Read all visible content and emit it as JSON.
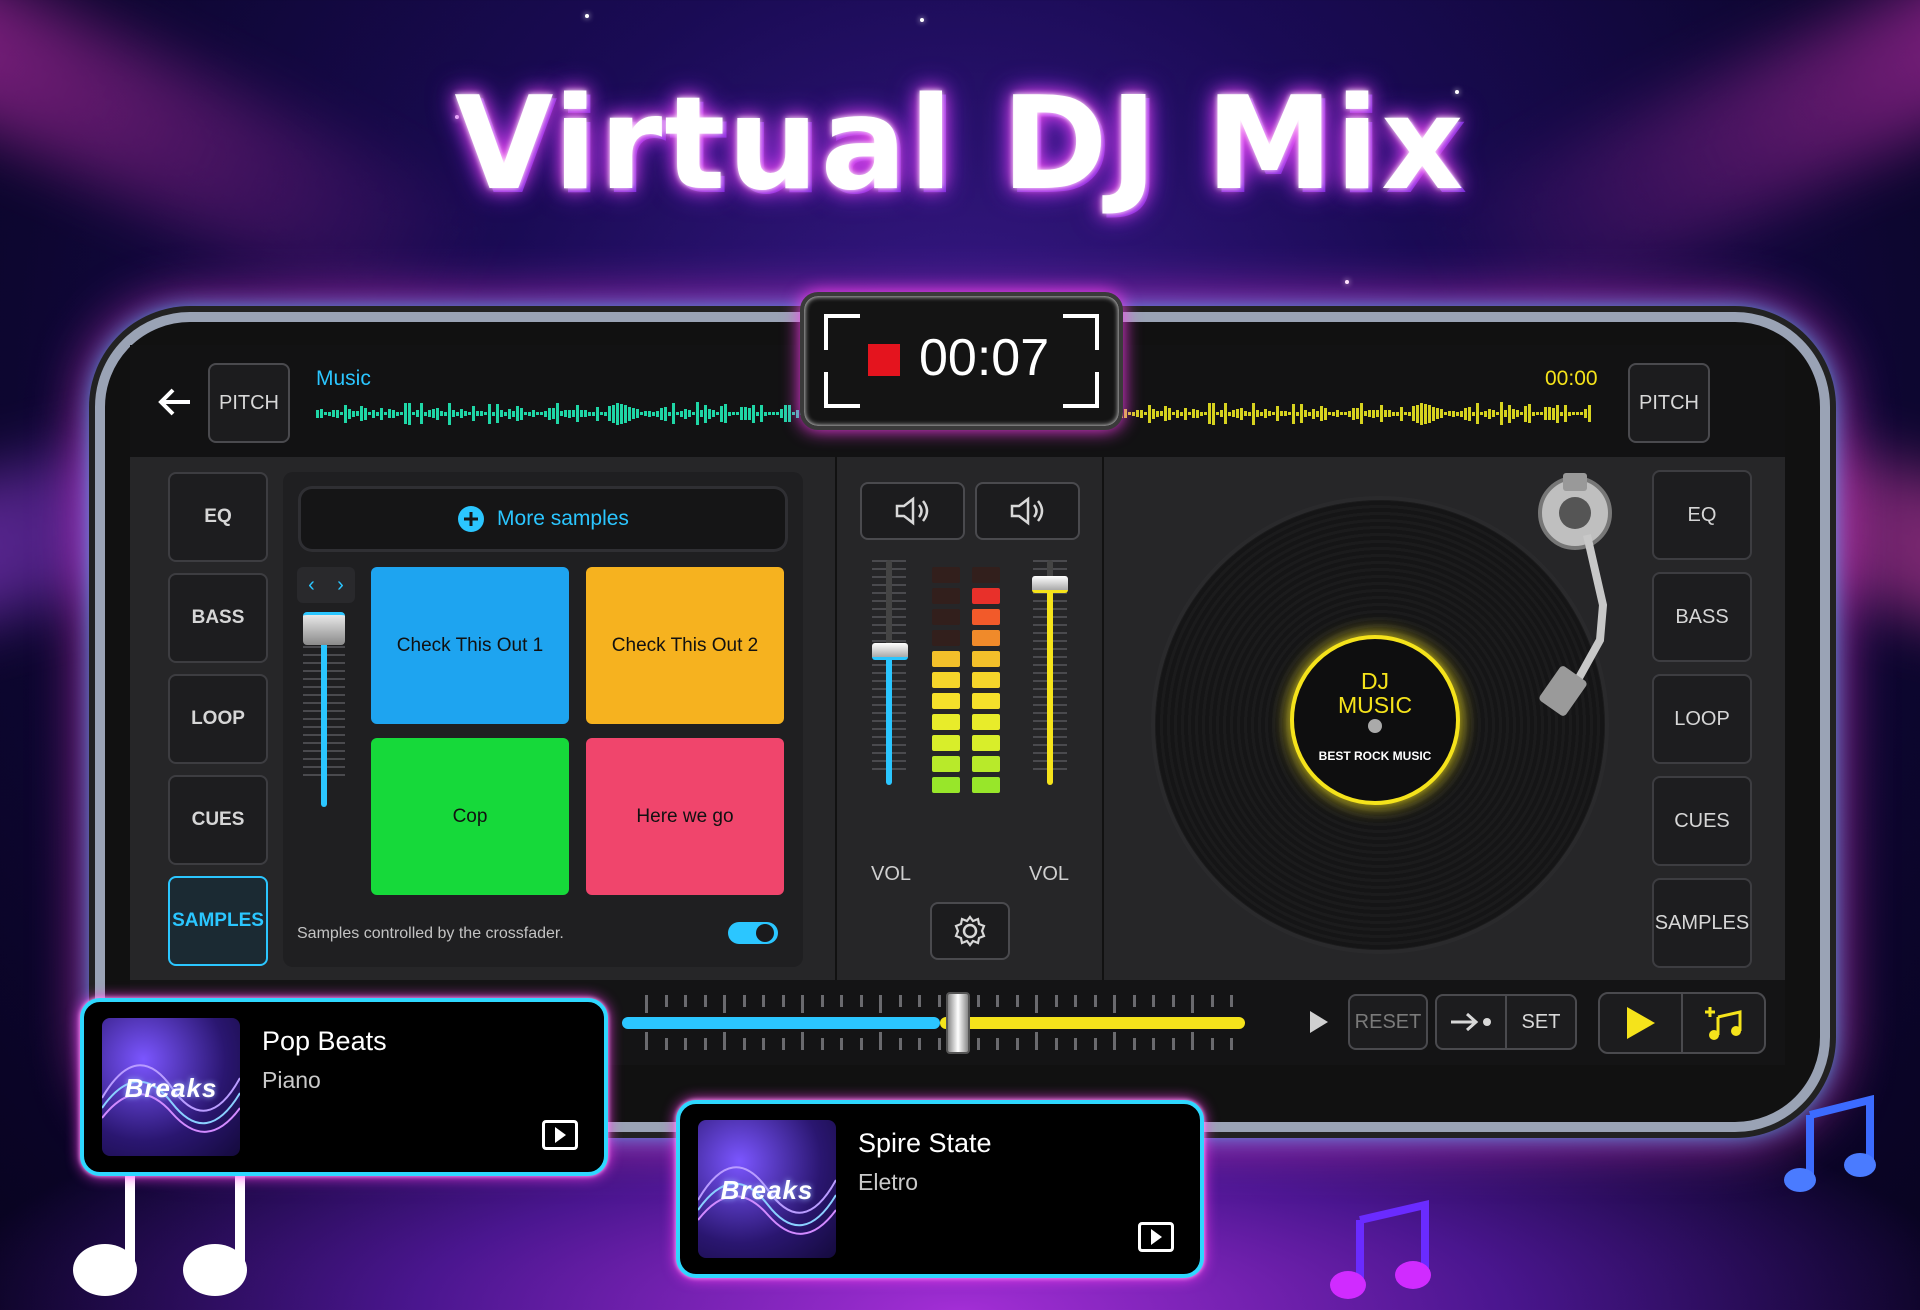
{
  "headline": "Virtual DJ Mix",
  "recorder": {
    "time": "00:07"
  },
  "top_bar": {
    "pitch_left": "PITCH",
    "pitch_right": "PITCH",
    "track_label": "Music",
    "right_time": "00:00"
  },
  "left_deck": {
    "buttons": [
      "EQ",
      "BASS",
      "LOOP",
      "CUES",
      "SAMPLES"
    ],
    "active_button": "SAMPLES",
    "more_samples": "More samples",
    "pads": [
      {
        "label": "Check This Out 1",
        "color": "#1ea4f0"
      },
      {
        "label": "Check This Out 2",
        "color": "#f6b21f"
      },
      {
        "label": "Cop",
        "color": "#16d93a"
      },
      {
        "label": "Here we go",
        "color": "#f0456c"
      }
    ],
    "crossfader_note": "Samples controlled by the crossfader.",
    "crossfader_toggle_on": true
  },
  "mixer": {
    "vol_left_label": "VOL",
    "vol_right_label": "VOL",
    "vol_left_level": 0.6,
    "vol_right_level": 0.9
  },
  "right_deck": {
    "buttons": [
      "EQ",
      "BASS",
      "LOOP",
      "CUES",
      "SAMPLES"
    ],
    "record_title": "DJ\nMUSIC",
    "record_sub": "BEST ROCK MUSIC"
  },
  "bottom_bar": {
    "reset": "RESET",
    "set": "SET",
    "crossfader_position": 0.54
  },
  "cards": [
    {
      "title": "Pop Beats",
      "subtitle": "Piano",
      "art_label": "Breaks"
    },
    {
      "title": "Spire State",
      "subtitle": "Eletro",
      "art_label": "Breaks"
    }
  ],
  "colors": {
    "accent_cyan": "#2bc6ff",
    "accent_yellow": "#f5e31b",
    "neon_pink": "#ff3ef3"
  }
}
